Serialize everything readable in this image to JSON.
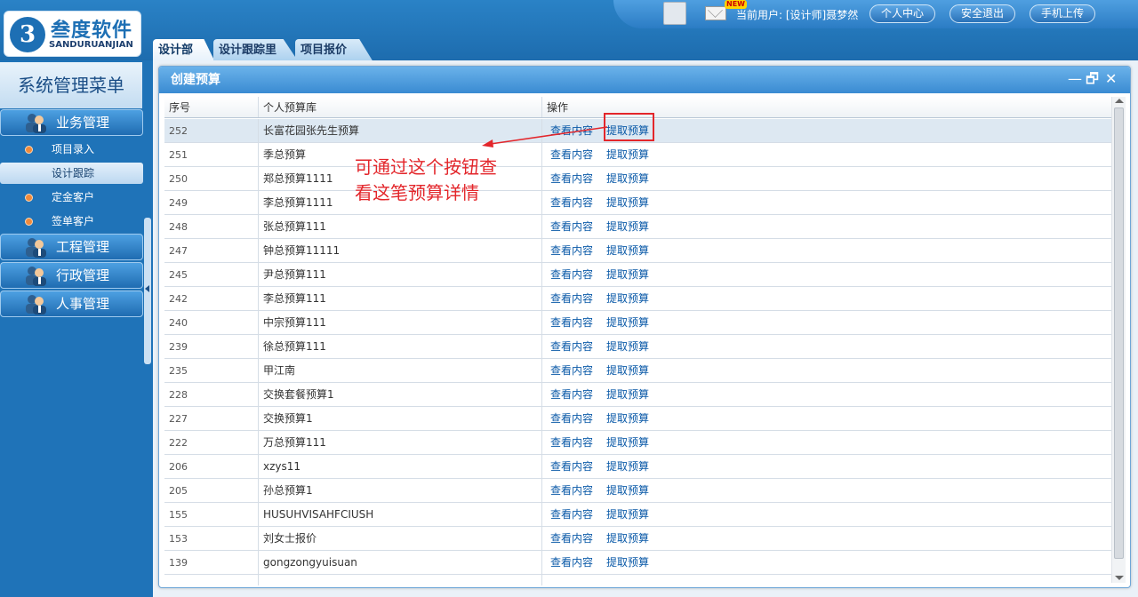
{
  "logo": {
    "mark": "3",
    "cn": "叁度软件",
    "en": "SANDURUANJIAN"
  },
  "userbar": {
    "new_badge": "NEW",
    "current_user": "当前用户: [设计师]聂梦然",
    "buttons": [
      "个人中心",
      "安全退出",
      "手机上传"
    ]
  },
  "tabs": [
    "设计部",
    "设计跟踪里",
    "项目报价"
  ],
  "sidebar": {
    "title": "系统管理菜单",
    "groups": [
      "业务管理",
      "工程管理",
      "行政管理",
      "人事管理"
    ],
    "subitems": [
      "项目录入",
      "设计跟踪",
      "定金客户",
      "签单客户"
    ]
  },
  "dialog": {
    "title": "创建预算",
    "controls": {
      "minimize": "—",
      "maximize": "🗗",
      "close": "✕"
    },
    "columns": [
      "序号",
      "个人预算库",
      "操作"
    ],
    "view_label": "查看内容",
    "extract_label": "提取预算",
    "rows": [
      {
        "id": "252",
        "name": "长富花园张先生预算"
      },
      {
        "id": "251",
        "name": "季总预算"
      },
      {
        "id": "250",
        "name": "郑总预算1111"
      },
      {
        "id": "249",
        "name": "李总预算1111"
      },
      {
        "id": "248",
        "name": "张总预算111"
      },
      {
        "id": "247",
        "name": "钟总预算11111"
      },
      {
        "id": "245",
        "name": "尹总预算111"
      },
      {
        "id": "242",
        "name": "李总预算111"
      },
      {
        "id": "240",
        "name": "中宗预算111"
      },
      {
        "id": "239",
        "name": "徐总预算111"
      },
      {
        "id": "235",
        "name": "甲江南"
      },
      {
        "id": "228",
        "name": "交换套餐预算1"
      },
      {
        "id": "227",
        "name": "交换预算1"
      },
      {
        "id": "222",
        "name": "万总预算111"
      },
      {
        "id": "206",
        "name": "xzys11"
      },
      {
        "id": "205",
        "name": "孙总预算1"
      },
      {
        "id": "155",
        "name": "HUSUHVISAHFCIUSH"
      },
      {
        "id": "153",
        "name": "刘女士报价"
      },
      {
        "id": "139",
        "name": "gongzongyuisuan"
      }
    ]
  },
  "annotation": {
    "line1": "可通过这个按钮查",
    "line2": "看这笔预算详情",
    "color": "#e3262b"
  },
  "colors": {
    "brand": "#1f73b8",
    "link": "#0b5aa8",
    "accent_orange": "#f08a3c"
  }
}
